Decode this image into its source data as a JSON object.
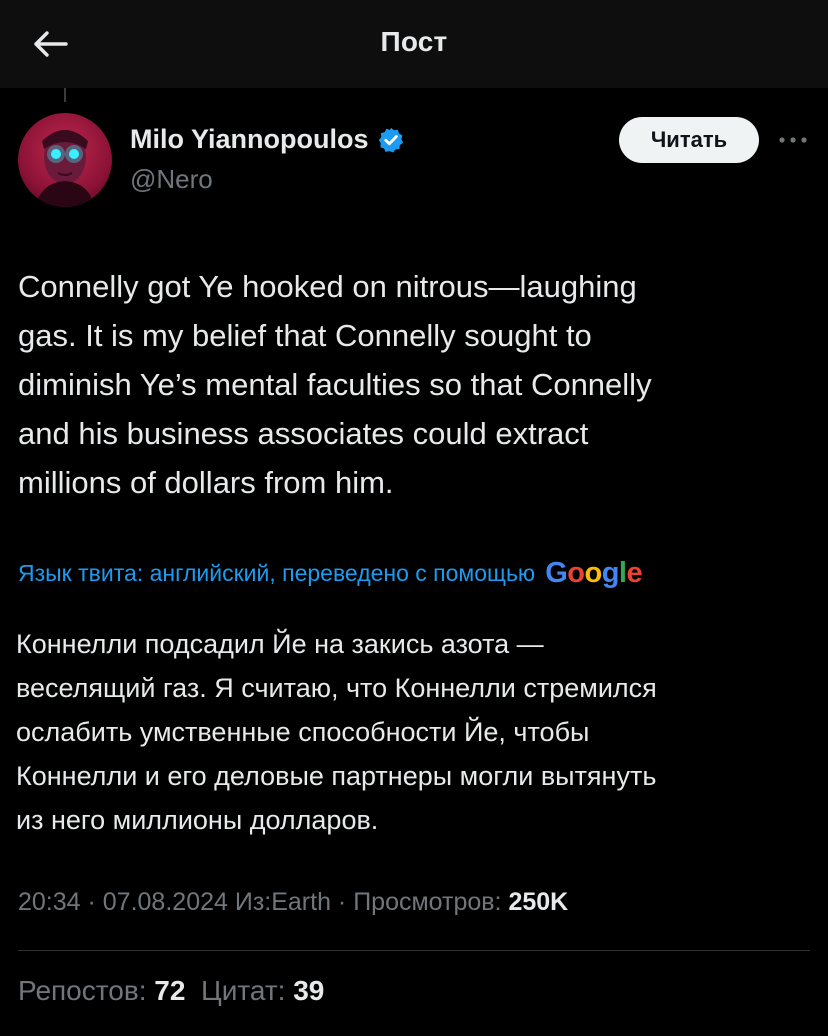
{
  "header": {
    "title": "Пост",
    "back_icon": "arrow-left-icon"
  },
  "author": {
    "name": "Milo Yiannopoulos",
    "handle": "@Nero",
    "verified": true,
    "verified_color": "#1d9bf0",
    "follow_label": "Читать",
    "more_icon": "ellipsis-icon"
  },
  "tweet": {
    "lines": [
      "Connelly got Ye hooked on nitrous—laughing",
      "gas. It is my belief that Connelly sought to",
      "diminish Ye’s mental faculties so that Connelly",
      "and his business associates could extract",
      "millions of dollars from him."
    ]
  },
  "translation": {
    "notice": "Язык твита: английский, переведено с помощью",
    "provider": "Google",
    "lines": [
      "Коннелли подсадил Йе на закись азота —",
      "веселящий газ. Я считаю, что Коннелли стремился",
      "ослабить умственные способности Йе, чтобы",
      "Коннелли и его деловые партнеры могли вытянуть",
      "из него миллионы долларов."
    ]
  },
  "meta": {
    "prefix": "20:34 · 07.08.2024 Из:Earth · Просмотров: ",
    "views": "250K"
  },
  "stats": {
    "reposts_label": "Репостов:",
    "reposts": "72",
    "quotes_label": "Цитат:",
    "quotes": "39"
  },
  "colors": {
    "background": "#000000",
    "header_bg": "#0e0e0e",
    "text": "#e7e9ea",
    "muted": "#71767b",
    "link": "#1d9bf0"
  }
}
